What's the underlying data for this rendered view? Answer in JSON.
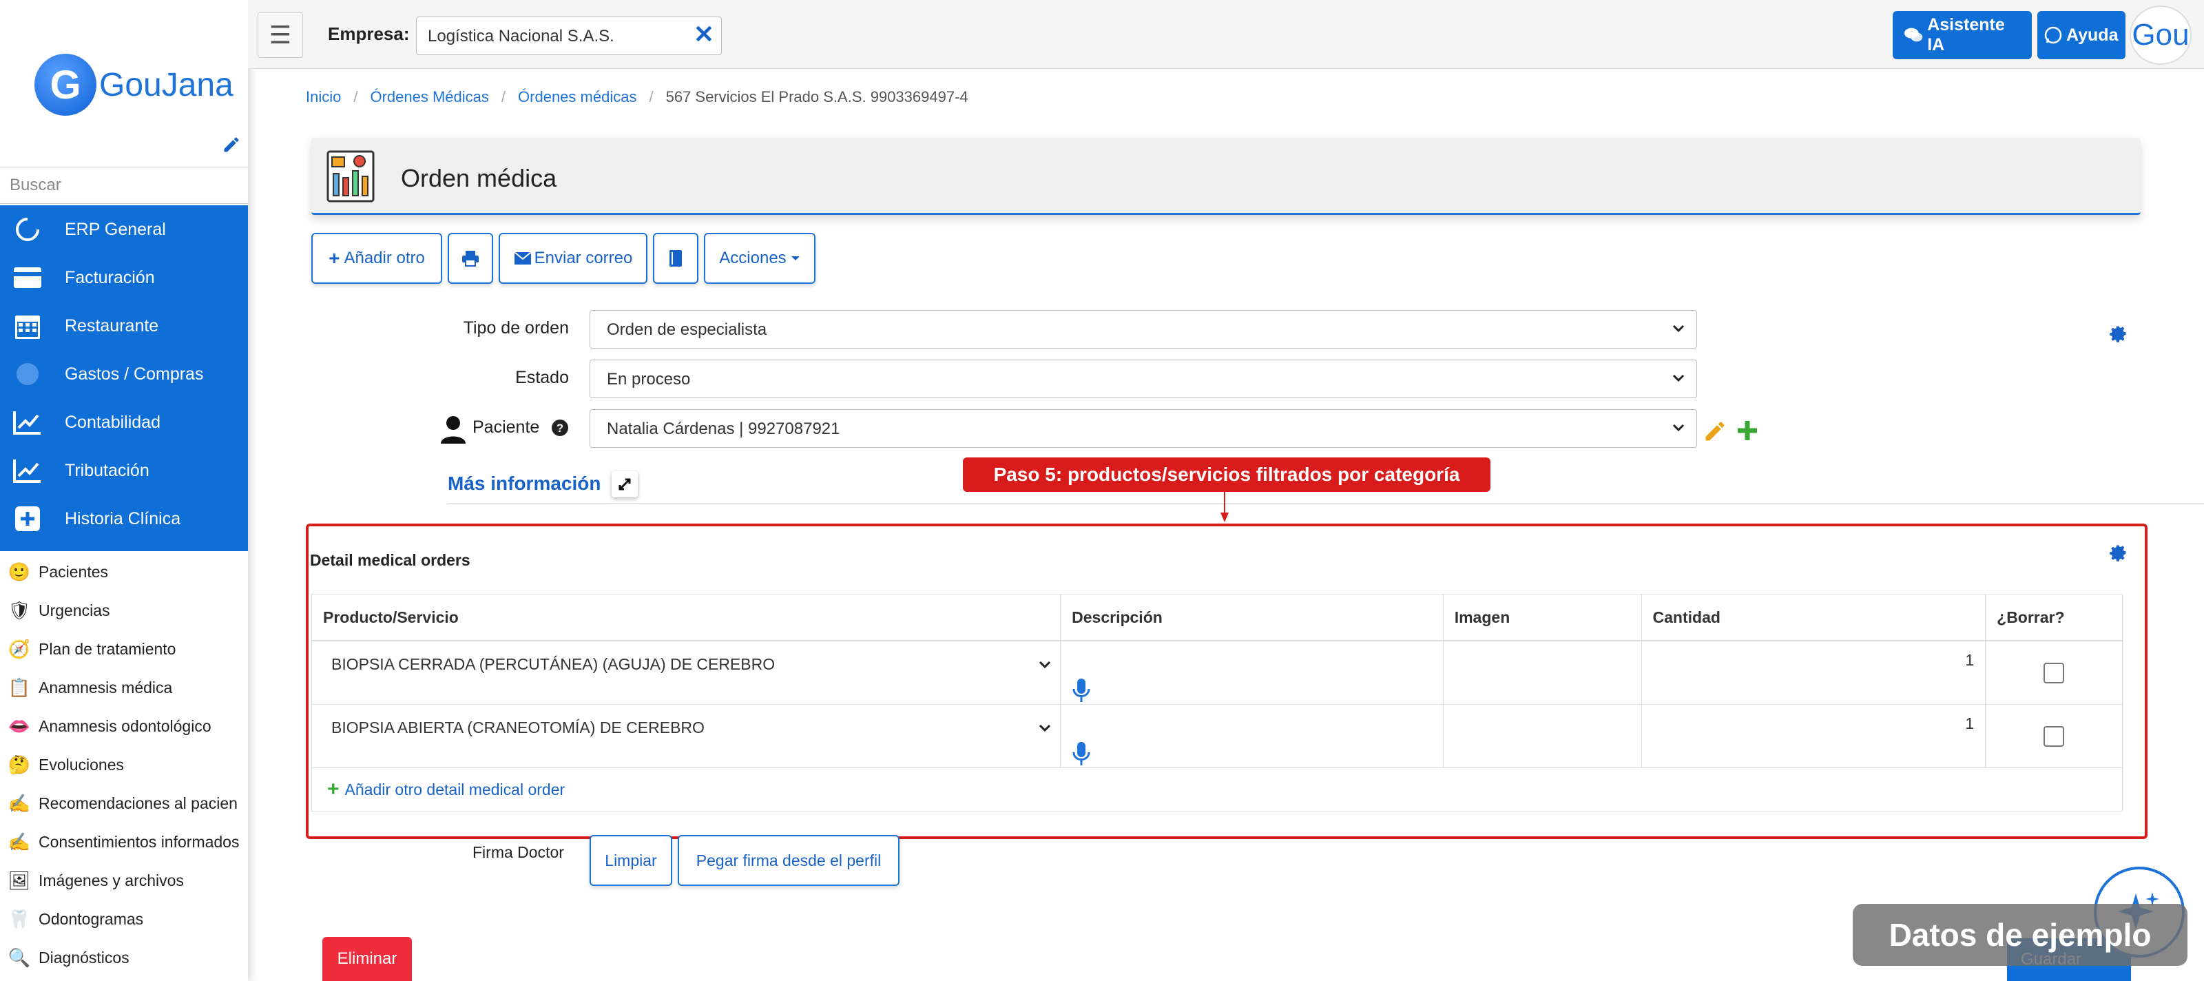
{
  "brand": {
    "logo_letter": "G",
    "logo_text": "GouJana"
  },
  "sidebar": {
    "search_placeholder": "Buscar",
    "nav": [
      {
        "label": "ERP General",
        "icon": "circle-refresh-icon"
      },
      {
        "label": "Facturación",
        "icon": "credit-card-icon"
      },
      {
        "label": "Restaurante",
        "icon": "calendar-icon"
      },
      {
        "label": "Gastos / Compras",
        "icon": "blurred-circle-icon"
      },
      {
        "label": "Contabilidad",
        "icon": "line-chart-icon"
      },
      {
        "label": "Tributación",
        "icon": "line-chart-icon"
      },
      {
        "label": "Historia Clínica",
        "icon": "plus-square-icon"
      }
    ],
    "subnav": [
      {
        "label": "Pacientes",
        "icon": "smiley-face-icon"
      },
      {
        "label": "Urgencias",
        "icon": "ambulance-shield-icon"
      },
      {
        "label": "Plan de tratamiento",
        "icon": "compass-plus-icon"
      },
      {
        "label": "Anamnesis médica",
        "icon": "doctor-clipboard-icon"
      },
      {
        "label": "Anamnesis odontológico",
        "icon": "mouth-icon"
      },
      {
        "label": "Evoluciones",
        "icon": "thinking-face-icon"
      },
      {
        "label": "Recomendaciones al pacien",
        "icon": "pen-sign-icon"
      },
      {
        "label": "Consentimientos informados",
        "icon": "pen-sign-icon"
      },
      {
        "label": "Imágenes y archivos",
        "icon": "images-icon"
      },
      {
        "label": "Odontogramas",
        "icon": "tooth-icon"
      },
      {
        "label": "Diagnósticos",
        "icon": "magnifier-icon"
      }
    ]
  },
  "topbar": {
    "empresa_label": "Empresa:",
    "empresa_value": "Logística Nacional S.A.S.",
    "asistente_label": "Asistente IA",
    "ayuda_label": "Ayuda",
    "avatar_text": "Gou"
  },
  "breadcrumb": {
    "items": [
      "Inicio",
      "Órdenes Médicas",
      "Órdenes médicas"
    ],
    "current": "567 Servicios El Prado S.A.S. 9903369497-4"
  },
  "page": {
    "title": "Orden médica"
  },
  "actions": {
    "add_label": "Añadir otro",
    "email_label": "Enviar correo",
    "acciones_label": "Acciones"
  },
  "form": {
    "tipo_label": "Tipo de orden",
    "tipo_value": "Orden de especialista",
    "estado_label": "Estado",
    "estado_value": "En proceso",
    "paciente_label": "Paciente",
    "paciente_value": "Natalia Cárdenas | 9927087921",
    "mas_info": "Más información"
  },
  "callout": "Paso 5: productos/servicios filtrados por categoría",
  "detail": {
    "title": "Detail medical orders",
    "headers": [
      "Producto/Servicio",
      "Descripción",
      "Imagen",
      "Cantidad",
      "¿Borrar?"
    ],
    "rows": [
      {
        "producto": "BIOPSIA CERRADA (PERCUTÁNEA) (AGUJA) DE CEREBRO",
        "cantidad": "1"
      },
      {
        "producto": "BIOPSIA ABIERTA (CRANEOTOMÍA) DE CEREBRO",
        "cantidad": "1"
      }
    ],
    "add_label": "Añadir otro detail medical order"
  },
  "firma": {
    "label": "Firma Doctor",
    "limpiar": "Limpiar",
    "pegar": "Pegar firma desde el perfil"
  },
  "footer": {
    "eliminar": "Eliminar",
    "guardar": "Guardar",
    "watermark": "Datos de ejemplo"
  },
  "colors": {
    "primary": "#0f6fd6",
    "danger": "#d81b1b",
    "success": "#3aa935"
  }
}
